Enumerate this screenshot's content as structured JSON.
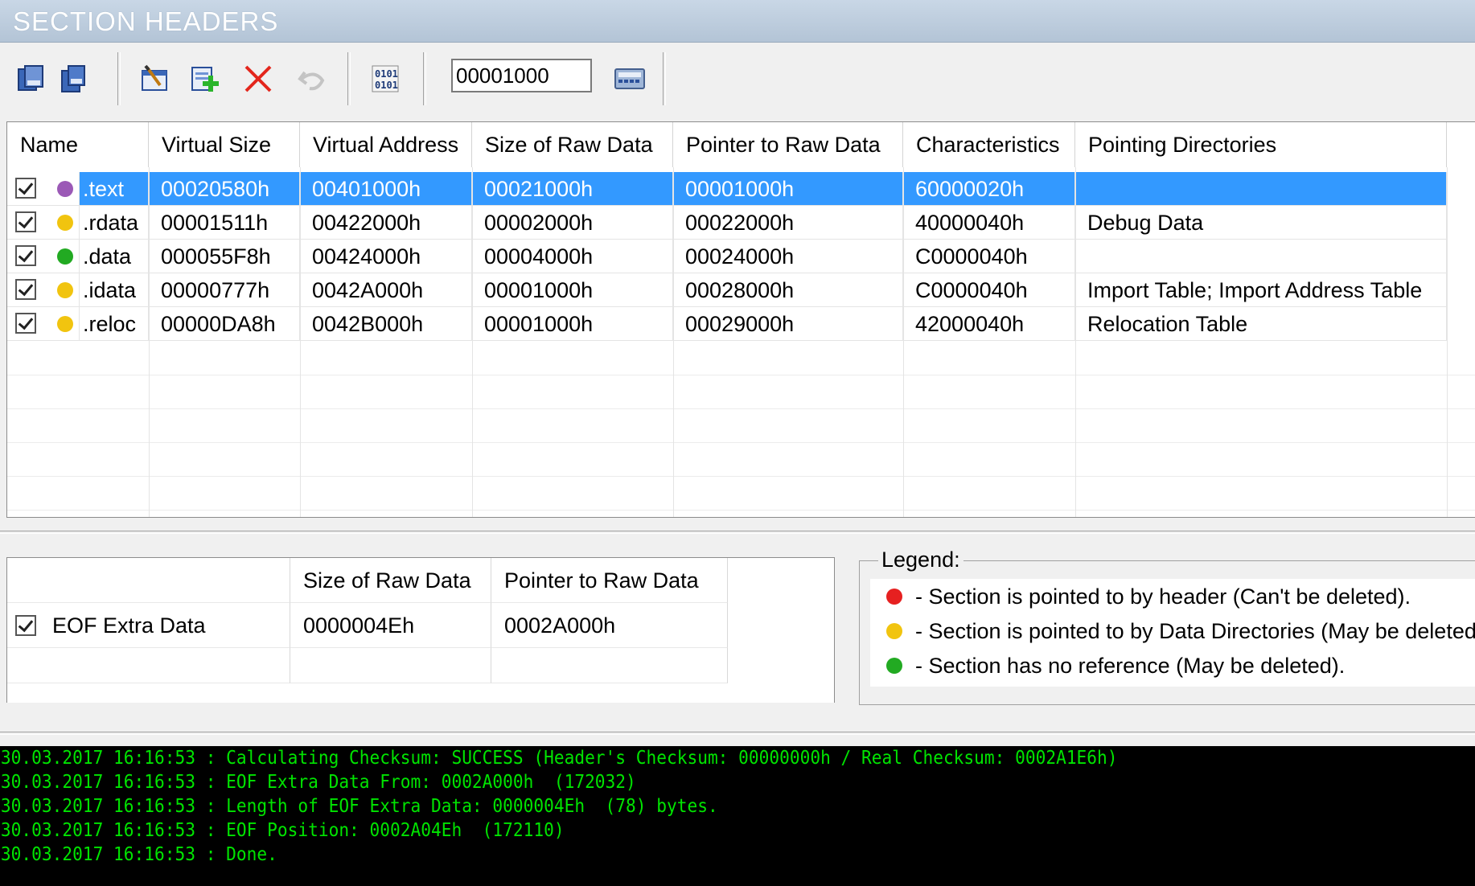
{
  "title": "SECTION HEADERS",
  "toolbar": {
    "offset_value": "00001000",
    "buttons": [
      {
        "name": "copy-sections-button",
        "icon": "copy-icon"
      },
      {
        "name": "paste-sections-button",
        "icon": "paste-icon"
      },
      {
        "name": "edit-section-button",
        "icon": "edit-icon"
      },
      {
        "name": "add-section-button",
        "icon": "add-icon"
      },
      {
        "name": "delete-section-button",
        "icon": "delete-icon"
      },
      {
        "name": "undo-button",
        "icon": "undo-icon"
      },
      {
        "name": "hex-view-button",
        "icon": "binary-icon"
      },
      {
        "name": "calculator-button",
        "icon": "calculator-icon"
      }
    ]
  },
  "sections": {
    "columns": [
      "Name",
      "Virtual Size",
      "Virtual Address",
      "Size of Raw Data",
      "Pointer to Raw Data",
      "Characteristics",
      "Pointing Directories"
    ],
    "rows": [
      {
        "name": ".text",
        "dot_color": "#9b59b6",
        "virtual_size": "00020580h",
        "virtual_address": "00401000h",
        "size_raw": "00021000h",
        "pointer_raw": "00001000h",
        "characteristics": "60000020h",
        "pointing": "",
        "selected": true
      },
      {
        "name": ".rdata",
        "dot_color": "#f1c40f",
        "virtual_size": "00001511h",
        "virtual_address": "00422000h",
        "size_raw": "00002000h",
        "pointer_raw": "00022000h",
        "characteristics": "40000040h",
        "pointing": "Debug Data",
        "selected": false
      },
      {
        "name": ".data",
        "dot_color": "#22aa22",
        "virtual_size": "000055F8h",
        "virtual_address": "00424000h",
        "size_raw": "00004000h",
        "pointer_raw": "00024000h",
        "characteristics": "C0000040h",
        "pointing": "",
        "selected": false
      },
      {
        "name": ".idata",
        "dot_color": "#f1c40f",
        "virtual_size": "00000777h",
        "virtual_address": "0042A000h",
        "size_raw": "00001000h",
        "pointer_raw": "00028000h",
        "characteristics": "C0000040h",
        "pointing": "Import Table; Import Address Table",
        "selected": false
      },
      {
        "name": ".reloc",
        "dot_color": "#f1c40f",
        "virtual_size": "00000DA8h",
        "virtual_address": "0042B000h",
        "size_raw": "00001000h",
        "pointer_raw": "00029000h",
        "characteristics": "42000040h",
        "pointing": "Relocation Table",
        "selected": false
      }
    ]
  },
  "eof": {
    "columns": [
      "Size of Raw Data",
      "Pointer to Raw Data"
    ],
    "label": "EOF Extra Data",
    "size_raw": "0000004Eh",
    "pointer_raw": "0002A000h"
  },
  "legend": {
    "title": "Legend:",
    "items": [
      {
        "color": "#e62020",
        "text": "- Section is pointed to by header (Can't be deleted)."
      },
      {
        "color": "#f1c40f",
        "text": "- Section is pointed to by Data Directories (May be deleted)."
      },
      {
        "color": "#22aa22",
        "text": "- Section has no reference (May be deleted)."
      }
    ]
  },
  "log": [
    "30.03.2017 16:16:53 : Calculating Checksum: SUCCESS (Header's Checksum: 00000000h / Real Checksum: 0002A1E6h)",
    "30.03.2017 16:16:53 : EOF Extra Data From: 0002A000h  (172032)",
    "30.03.2017 16:16:53 : Length of EOF Extra Data: 0000004Eh  (78) bytes.",
    "30.03.2017 16:16:53 : EOF Position: 0002A04Eh  (172110)",
    "30.03.2017 16:16:53 : Done."
  ]
}
